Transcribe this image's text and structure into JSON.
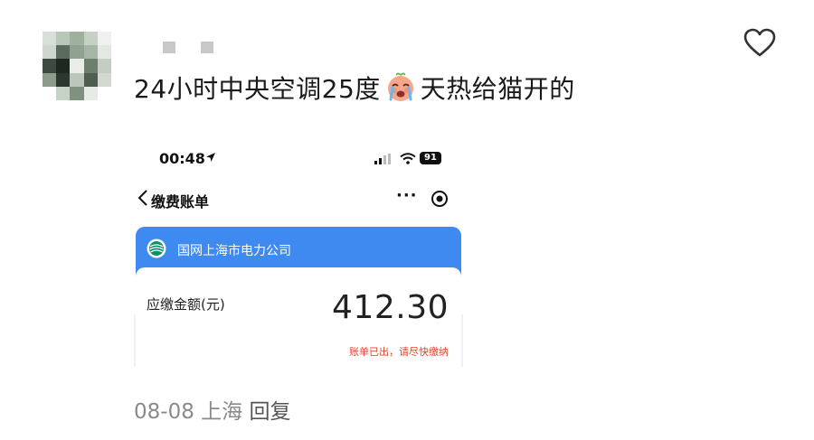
{
  "comment": {
    "text_before_emoji": "24小时中央空调25度",
    "emoji": "crying-face-emoji",
    "text_after_emoji": "天热给猫开的",
    "date": "08-08",
    "location": "上海",
    "reply_label": "回复"
  },
  "screenshot": {
    "status_bar": {
      "time": "00:48",
      "battery": "91"
    },
    "nav": {
      "title": "缴费账单",
      "more": "···"
    },
    "bill": {
      "company": "国网上海市电力公司",
      "amount_label": "应缴金额(元)",
      "amount": "412.30",
      "notice": "账单已出，请尽快缴纳"
    }
  },
  "colors": {
    "card_blue": "#3f8af0",
    "notice_red": "#e0442c",
    "meta_gray": "#8a8a8a"
  }
}
